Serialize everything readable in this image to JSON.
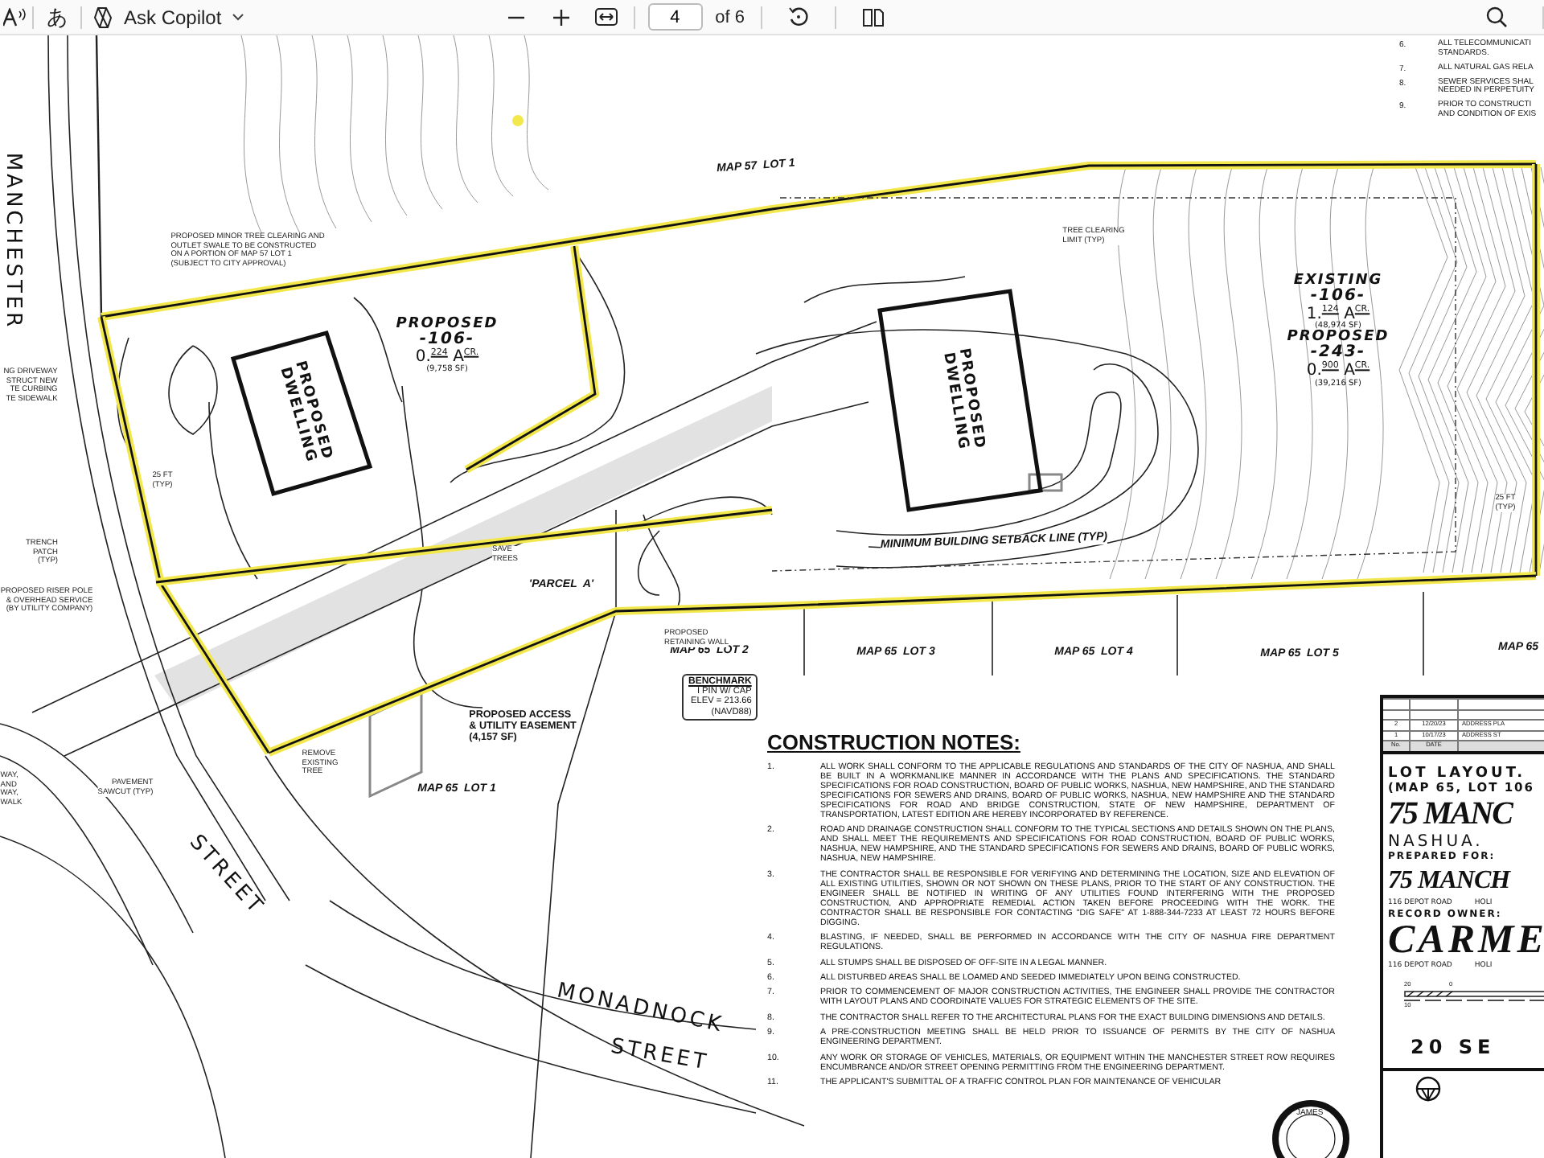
{
  "toolbar": {
    "translate": "あ",
    "copilot": "Ask Copilot",
    "page": "4",
    "page_count": "of 6"
  },
  "top_notes": [
    {
      "number": "6.",
      "lines": [
        "ALL TELECOMMUNICATI",
        "STANDARDS."
      ]
    },
    {
      "number": "7.",
      "lines": [
        "ALL NATURAL GAS RELA"
      ]
    },
    {
      "number": "8.",
      "lines": [
        "SEWER SERVICES SHAL",
        "NEEDED IN PERPETUITY"
      ]
    },
    {
      "number": "9.",
      "lines": [
        "PRIOR TO CONSTRUCTI",
        "AND CONDITION OF EXIS"
      ]
    }
  ],
  "plan_labels": [
    {
      "kind": "street",
      "text": "MANCHESTER"
    },
    {
      "kind": "street",
      "text": "STREET"
    },
    {
      "kind": "street",
      "text": "MONADNOCK"
    },
    {
      "kind": "street",
      "text": "STREET"
    },
    {
      "kind": "map",
      "text": "MAP 57  LOT 1"
    },
    {
      "kind": "map",
      "text": "MAP 65  LOT 2"
    },
    {
      "kind": "map",
      "text": "MAP 65  LOT 3"
    },
    {
      "kind": "map",
      "text": "MAP 65  LOT 4"
    },
    {
      "kind": "map",
      "text": "MAP 65  LOT 5"
    },
    {
      "kind": "map",
      "text": "MAP 65"
    },
    {
      "kind": "map",
      "text": "MAP 65  LOT 1"
    },
    {
      "kind": "dwelling",
      "text": "PROPOSED\nDWELLING"
    },
    {
      "kind": "dwelling",
      "text": "PROPOSED\nDWELLING"
    },
    {
      "kind": "callout",
      "text": "PROPOSED MINOR TREE CLEARING AND\nOUTLET SWALE TO BE CONSTRUCTED\nON A PORTION OF MAP 57 LOT 1\n(SUBJECT TO CITY APPROVAL)"
    },
    {
      "kind": "callout",
      "text": "TREE CLEARING\nLIMIT (TYP)"
    },
    {
      "kind": "map",
      "text": "MINIMUM BUILDING SETBACK LINE (TYP)"
    },
    {
      "kind": "callout",
      "text": "NG DRIVEWAY\nSTRUCT NEW\nTE CURBING\nTE SIDEWALK"
    },
    {
      "kind": "callout",
      "text": "TRENCH\nPATCH\n(TYP)"
    },
    {
      "kind": "callout",
      "text": "PROPOSED RISER POLE\n& OVERHEAD SERVICE\n(BY UTILITY COMPANY)"
    },
    {
      "kind": "callout",
      "text": "SAVE\nTREES"
    },
    {
      "kind": "callout",
      "text": "PROPOSED\nRETAINING WALL"
    },
    {
      "kind": "map",
      "text": "'PARCEL  A'"
    },
    {
      "kind": "easement",
      "text": "PROPOSED ACCESS\n& UTILITY EASEMENT\n(4,157 SF)"
    },
    {
      "kind": "callout",
      "text": "REMOVE\nEXISTING\nTREE"
    },
    {
      "kind": "callout",
      "text": "WAY,\nAND\nWAY,\nWALK"
    },
    {
      "kind": "callout",
      "text": "PAVEMENT\nSAWCUT (TYP)"
    },
    {
      "kind": "callout",
      "text": "25 FT\n(TYP)"
    },
    {
      "kind": "callout",
      "text": "25 FT\n(TYP)"
    }
  ],
  "lot_areas": [
    {
      "lines": [
        {
          "kind": "heading",
          "text": "PROPOSED"
        },
        {
          "kind": "number",
          "text": "-106-"
        },
        {
          "kind": "acreage",
          "text": "0.$^{224}$ A$^{CR.}$"
        },
        {
          "kind": "area",
          "text": "(9,758  SF)"
        }
      ]
    },
    {
      "lines": [
        {
          "kind": "heading",
          "text": "EXISTING"
        },
        {
          "kind": "number",
          "text": "-106-"
        },
        {
          "kind": "acreage",
          "text": "1.$^{124}$ A$^{CR.}$"
        },
        {
          "kind": "area",
          "text": "(48,974  SF)"
        },
        {
          "kind": "heading",
          "text": "PROPOSED"
        },
        {
          "kind": "number",
          "text": "-243-"
        },
        {
          "kind": "acreage",
          "text": "0.$^{900}$ A$^{CR.}$"
        },
        {
          "kind": "area",
          "text": "(39,216  SF)"
        }
      ]
    }
  ],
  "benchmark": {
    "title": "BENCHMARK",
    "lines": [
      "I PIN W/ CAP",
      "ELEV = 213.66",
      "(NAVD88)"
    ]
  },
  "construction_notes": {
    "title": "CONSTRUCTION NOTES:",
    "items": [
      {
        "number": "1.",
        "text": "ALL WORK SHALL CONFORM TO THE APPLICABLE REGULATIONS AND STANDARDS OF THE CITY OF NASHUA, AND SHALL BE BUILT IN A WORKMANLIKE MANNER IN ACCORDANCE WITH THE PLANS AND SPECIFICATIONS.  THE STANDARD SPECIFICATIONS FOR ROAD CONSTRUCTION, BOARD OF PUBLIC WORKS, NASHUA, NEW HAMPSHIRE, AND THE STANDARD SPECIFICATIONS FOR SEWERS AND DRAINS, BOARD OF PUBLIC WORKS, NASHUA, NEW HAMPSHIRE AND THE STANDARD SPECIFICATIONS FOR ROAD AND BRIDGE CONSTRUCTION, STATE OF NEW HAMPSHIRE, DEPARTMENT OF TRANSPORTATION, LATEST EDITION ARE HEREBY INCORPORATED BY REFERENCE."
      },
      {
        "number": "2.",
        "text": "ROAD AND DRAINAGE CONSTRUCTION SHALL CONFORM TO THE TYPICAL SECTIONS AND DETAILS SHOWN ON THE PLANS, AND SHALL MEET THE REQUIREMENTS AND SPECIFICATIONS FOR ROAD CONSTRUCTION, BOARD OF PUBLIC WORKS, NASHUA, NEW HAMPSHIRE, AND THE STANDARD SPECIFICATIONS FOR SEWERS AND DRAINS, BOARD OF PUBLIC WORKS, NASHUA, NEW HAMPSHIRE."
      },
      {
        "number": "3.",
        "text": "THE CONTRACTOR SHALL BE RESPONSIBLE FOR VERIFYING AND DETERMINING THE LOCATION, SIZE AND ELEVATION OF ALL EXISTING UTILITIES, SHOWN OR NOT SHOWN ON THESE PLANS, PRIOR TO THE START OF ANY CONSTRUCTION.  THE ENGINEER SHALL BE NOTIFIED IN WRITING OF ANY UTILITIES FOUND INTERFERING WITH THE PROPOSED CONSTRUCTION, AND APPROPRIATE REMEDIAL ACTION TAKEN BEFORE PROCEEDING WITH THE WORK.  THE CONTRACTOR SHALL BE RESPONSIBLE FOR CONTACTING \"DIG SAFE\" AT 1-888-344-7233 AT LEAST 72 HOURS BEFORE DIGGING."
      },
      {
        "number": "4.",
        "text": "BLASTING, IF NEEDED, SHALL BE PERFORMED IN ACCORDANCE WITH THE CITY OF NASHUA FIRE DEPARTMENT REGULATIONS."
      },
      {
        "number": "5.",
        "text": "ALL STUMPS SHALL BE DISPOSED OF OFF-SITE IN A LEGAL MANNER."
      },
      {
        "number": "6.",
        "text": "ALL DISTURBED AREAS SHALL BE LOAMED AND SEEDED IMMEDIATELY UPON BEING CONSTRUCTED."
      },
      {
        "number": "7.",
        "text": "PRIOR TO COMMENCEMENT OF MAJOR CONSTRUCTION ACTIVITIES, THE ENGINEER SHALL PROVIDE THE CONTRACTOR WITH LAYOUT PLANS AND COORDINATE VALUES FOR STRATEGIC ELEMENTS OF THE SITE."
      },
      {
        "number": "8.",
        "text": "THE CONTRACTOR SHALL REFER TO THE ARCHITECTURAL PLANS FOR THE EXACT BUILDING DIMENSIONS AND DETAILS."
      },
      {
        "number": "9.",
        "text": "A PRE-CONSTRUCTION MEETING SHALL BE HELD PRIOR TO ISSUANCE OF PERMITS BY THE CITY OF NASHUA ENGINEERING DEPARTMENT."
      },
      {
        "number": "10.",
        "text": "ANY WORK OR STORAGE OF VEHICLES, MATERIALS, OR EQUIPMENT WITHIN THE MANCHESTER STREET ROW REQUIRES ENCUMBRANCE AND/OR STREET OPENING PERMITTING FROM THE ENGINEERING DEPARTMENT."
      },
      {
        "number": "11.",
        "text": "THE APPLICANT'S SUBMITTAL OF A TRAFFIC CONTROL PLAN FOR MAINTENANCE OF VEHICULAR"
      }
    ]
  },
  "seal": {
    "name": "JAMES"
  },
  "title_block": {
    "revisions": [
      {
        "no": "2",
        "date": "12/20/23",
        "description": "ADDRESS PLA"
      },
      {
        "no": "1",
        "date": "10/17/23",
        "description": "ADDRESS ST"
      }
    ],
    "header": [
      "No.",
      "DATE"
    ],
    "title": "LOT LAYOUT.",
    "subtitle": "(MAP 65,  LOT 106",
    "project": "75 MANC",
    "city": "NASHUA.",
    "prepared_label": "PREPARED FOR:",
    "client": "75 MANCH",
    "client_address": [
      "116 DEPOT ROAD",
      "HOLI"
    ],
    "owner_label": "RECORD OWNER:",
    "owner": "CARME",
    "owner_address": [
      "116 DEPOT ROAD",
      "HOLI"
    ],
    "scale_ticks": [
      "20",
      "0",
      "10"
    ],
    "scale": "20 SE"
  }
}
